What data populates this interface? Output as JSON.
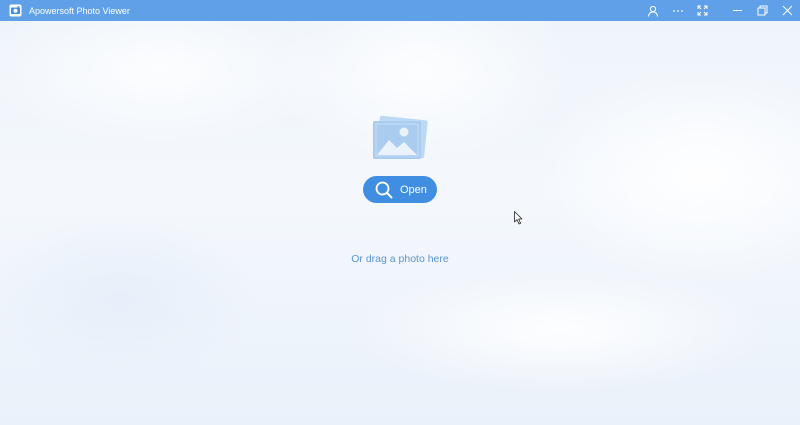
{
  "window": {
    "title": "Apowersoft Photo Viewer"
  },
  "titlebar": {
    "buttons": [
      {
        "name": "account",
        "icon": "user-icon"
      },
      {
        "name": "more",
        "icon": "more-dots-icon"
      },
      {
        "name": "fullscreen",
        "icon": "fullscreen-icon"
      },
      {
        "name": "minimize",
        "icon": "minimize-icon"
      },
      {
        "name": "restore",
        "icon": "restore-icon"
      },
      {
        "name": "close",
        "icon": "close-icon"
      }
    ]
  },
  "main": {
    "open_label": "Open",
    "drag_hint": "Or drag a photo here",
    "photo_icon": "photo-stack-icon",
    "open_icon": "search-icon"
  },
  "colors": {
    "titlebar": "#5fa0e8",
    "accent": "#3f8ee2",
    "hint_text": "#5a94cf",
    "icon_light": "#a9ccef"
  }
}
